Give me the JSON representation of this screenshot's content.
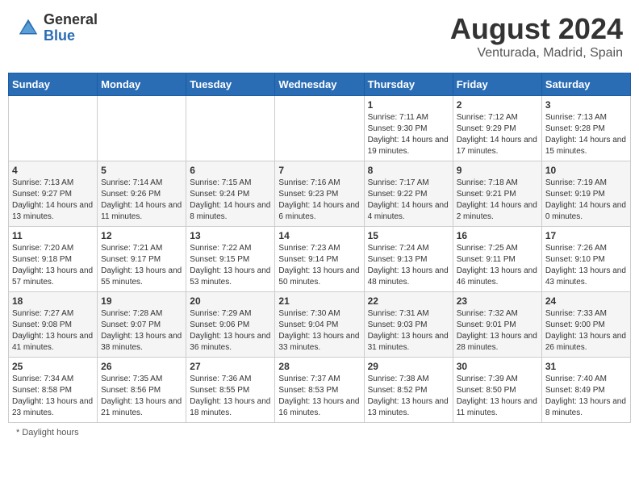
{
  "header": {
    "logo_general": "General",
    "logo_blue": "Blue",
    "month_title": "August 2024",
    "location": "Venturada, Madrid, Spain"
  },
  "days_of_week": [
    "Sunday",
    "Monday",
    "Tuesday",
    "Wednesday",
    "Thursday",
    "Friday",
    "Saturday"
  ],
  "weeks": [
    [
      {
        "day": "",
        "info": ""
      },
      {
        "day": "",
        "info": ""
      },
      {
        "day": "",
        "info": ""
      },
      {
        "day": "",
        "info": ""
      },
      {
        "day": "1",
        "info": "Sunrise: 7:11 AM\nSunset: 9:30 PM\nDaylight: 14 hours\nand 19 minutes."
      },
      {
        "day": "2",
        "info": "Sunrise: 7:12 AM\nSunset: 9:29 PM\nDaylight: 14 hours\nand 17 minutes."
      },
      {
        "day": "3",
        "info": "Sunrise: 7:13 AM\nSunset: 9:28 PM\nDaylight: 14 hours\nand 15 minutes."
      }
    ],
    [
      {
        "day": "4",
        "info": "Sunrise: 7:13 AM\nSunset: 9:27 PM\nDaylight: 14 hours\nand 13 minutes."
      },
      {
        "day": "5",
        "info": "Sunrise: 7:14 AM\nSunset: 9:26 PM\nDaylight: 14 hours\nand 11 minutes."
      },
      {
        "day": "6",
        "info": "Sunrise: 7:15 AM\nSunset: 9:24 PM\nDaylight: 14 hours\nand 8 minutes."
      },
      {
        "day": "7",
        "info": "Sunrise: 7:16 AM\nSunset: 9:23 PM\nDaylight: 14 hours\nand 6 minutes."
      },
      {
        "day": "8",
        "info": "Sunrise: 7:17 AM\nSunset: 9:22 PM\nDaylight: 14 hours\nand 4 minutes."
      },
      {
        "day": "9",
        "info": "Sunrise: 7:18 AM\nSunset: 9:21 PM\nDaylight: 14 hours\nand 2 minutes."
      },
      {
        "day": "10",
        "info": "Sunrise: 7:19 AM\nSunset: 9:19 PM\nDaylight: 14 hours\nand 0 minutes."
      }
    ],
    [
      {
        "day": "11",
        "info": "Sunrise: 7:20 AM\nSunset: 9:18 PM\nDaylight: 13 hours\nand 57 minutes."
      },
      {
        "day": "12",
        "info": "Sunrise: 7:21 AM\nSunset: 9:17 PM\nDaylight: 13 hours\nand 55 minutes."
      },
      {
        "day": "13",
        "info": "Sunrise: 7:22 AM\nSunset: 9:15 PM\nDaylight: 13 hours\nand 53 minutes."
      },
      {
        "day": "14",
        "info": "Sunrise: 7:23 AM\nSunset: 9:14 PM\nDaylight: 13 hours\nand 50 minutes."
      },
      {
        "day": "15",
        "info": "Sunrise: 7:24 AM\nSunset: 9:13 PM\nDaylight: 13 hours\nand 48 minutes."
      },
      {
        "day": "16",
        "info": "Sunrise: 7:25 AM\nSunset: 9:11 PM\nDaylight: 13 hours\nand 46 minutes."
      },
      {
        "day": "17",
        "info": "Sunrise: 7:26 AM\nSunset: 9:10 PM\nDaylight: 13 hours\nand 43 minutes."
      }
    ],
    [
      {
        "day": "18",
        "info": "Sunrise: 7:27 AM\nSunset: 9:08 PM\nDaylight: 13 hours\nand 41 minutes."
      },
      {
        "day": "19",
        "info": "Sunrise: 7:28 AM\nSunset: 9:07 PM\nDaylight: 13 hours\nand 38 minutes."
      },
      {
        "day": "20",
        "info": "Sunrise: 7:29 AM\nSunset: 9:06 PM\nDaylight: 13 hours\nand 36 minutes."
      },
      {
        "day": "21",
        "info": "Sunrise: 7:30 AM\nSunset: 9:04 PM\nDaylight: 13 hours\nand 33 minutes."
      },
      {
        "day": "22",
        "info": "Sunrise: 7:31 AM\nSunset: 9:03 PM\nDaylight: 13 hours\nand 31 minutes."
      },
      {
        "day": "23",
        "info": "Sunrise: 7:32 AM\nSunset: 9:01 PM\nDaylight: 13 hours\nand 28 minutes."
      },
      {
        "day": "24",
        "info": "Sunrise: 7:33 AM\nSunset: 9:00 PM\nDaylight: 13 hours\nand 26 minutes."
      }
    ],
    [
      {
        "day": "25",
        "info": "Sunrise: 7:34 AM\nSunset: 8:58 PM\nDaylight: 13 hours\nand 23 minutes."
      },
      {
        "day": "26",
        "info": "Sunrise: 7:35 AM\nSunset: 8:56 PM\nDaylight: 13 hours\nand 21 minutes."
      },
      {
        "day": "27",
        "info": "Sunrise: 7:36 AM\nSunset: 8:55 PM\nDaylight: 13 hours\nand 18 minutes."
      },
      {
        "day": "28",
        "info": "Sunrise: 7:37 AM\nSunset: 8:53 PM\nDaylight: 13 hours\nand 16 minutes."
      },
      {
        "day": "29",
        "info": "Sunrise: 7:38 AM\nSunset: 8:52 PM\nDaylight: 13 hours\nand 13 minutes."
      },
      {
        "day": "30",
        "info": "Sunrise: 7:39 AM\nSunset: 8:50 PM\nDaylight: 13 hours\nand 11 minutes."
      },
      {
        "day": "31",
        "info": "Sunrise: 7:40 AM\nSunset: 8:49 PM\nDaylight: 13 hours\nand 8 minutes."
      }
    ]
  ],
  "footer": {
    "note": "Daylight hours"
  }
}
